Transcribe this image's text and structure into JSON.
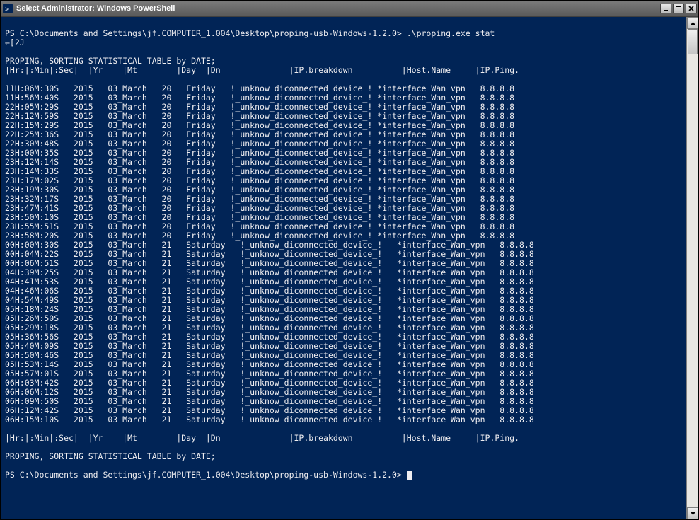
{
  "window": {
    "title": "Select Administrator: Windows PowerShell"
  },
  "prompt": {
    "path": "PS C:\\Documents and Settings\\jf.COMPUTER_1.004\\Desktop\\proping-usb-Windows-1.2.0>",
    "command": ".\\proping.exe stat"
  },
  "escape_seq": "←[2J",
  "heading": "PROPING, SORTING STATISTICAL TABLE by DATE;",
  "header_line": "|Hr:|:Min|:Sec|  |Yr    |Mt        |Day  |Dn              |IP.breakdown          |Host.Name     |IP.Ping.",
  "footer_header_line": "|Hr:|:Min|:Sec|  |Yr    |Mt        |Day  |Dn              |IP.breakdown          |Host.Name     |IP.Ping.",
  "table": [
    {
      "time": "11H:06M:30S",
      "yr": "2015",
      "mt": "03_March",
      "day": "20",
      "dn": "Friday",
      "ip": "!_unknow_diconnected_device_!",
      "host": "*interface_Wan_vpn",
      "ping": "8.8.8.8"
    },
    {
      "time": "11H:56M:40S",
      "yr": "2015",
      "mt": "03_March",
      "day": "20",
      "dn": "Friday",
      "ip": "!_unknow_diconnected_device_!",
      "host": "*interface_Wan_vpn",
      "ping": "8.8.8.8"
    },
    {
      "time": "22H:05M:29S",
      "yr": "2015",
      "mt": "03_March",
      "day": "20",
      "dn": "Friday",
      "ip": "!_unknow_diconnected_device_!",
      "host": "*interface_Wan_vpn",
      "ping": "8.8.8.8"
    },
    {
      "time": "22H:12M:59S",
      "yr": "2015",
      "mt": "03_March",
      "day": "20",
      "dn": "Friday",
      "ip": "!_unknow_diconnected_device_!",
      "host": "*interface_Wan_vpn",
      "ping": "8.8.8.8"
    },
    {
      "time": "22H:15M:29S",
      "yr": "2015",
      "mt": "03_March",
      "day": "20",
      "dn": "Friday",
      "ip": "!_unknow_diconnected_device_!",
      "host": "*interface_Wan_vpn",
      "ping": "8.8.8.8"
    },
    {
      "time": "22H:25M:36S",
      "yr": "2015",
      "mt": "03_March",
      "day": "20",
      "dn": "Friday",
      "ip": "!_unknow_diconnected_device_!",
      "host": "*interface_Wan_vpn",
      "ping": "8.8.8.8"
    },
    {
      "time": "22H:30M:48S",
      "yr": "2015",
      "mt": "03_March",
      "day": "20",
      "dn": "Friday",
      "ip": "!_unknow_diconnected_device_!",
      "host": "*interface_Wan_vpn",
      "ping": "8.8.8.8"
    },
    {
      "time": "23H:00M:35S",
      "yr": "2015",
      "mt": "03_March",
      "day": "20",
      "dn": "Friday",
      "ip": "!_unknow_diconnected_device_!",
      "host": "*interface_Wan_vpn",
      "ping": "8.8.8.8"
    },
    {
      "time": "23H:12M:14S",
      "yr": "2015",
      "mt": "03_March",
      "day": "20",
      "dn": "Friday",
      "ip": "!_unknow_diconnected_device_!",
      "host": "*interface_Wan_vpn",
      "ping": "8.8.8.8"
    },
    {
      "time": "23H:14M:33S",
      "yr": "2015",
      "mt": "03_March",
      "day": "20",
      "dn": "Friday",
      "ip": "!_unknow_diconnected_device_!",
      "host": "*interface_Wan_vpn",
      "ping": "8.8.8.8"
    },
    {
      "time": "23H:17M:02S",
      "yr": "2015",
      "mt": "03_March",
      "day": "20",
      "dn": "Friday",
      "ip": "!_unknow_diconnected_device_!",
      "host": "*interface_Wan_vpn",
      "ping": "8.8.8.8"
    },
    {
      "time": "23H:19M:30S",
      "yr": "2015",
      "mt": "03_March",
      "day": "20",
      "dn": "Friday",
      "ip": "!_unknow_diconnected_device_!",
      "host": "*interface_Wan_vpn",
      "ping": "8.8.8.8"
    },
    {
      "time": "23H:32M:17S",
      "yr": "2015",
      "mt": "03_March",
      "day": "20",
      "dn": "Friday",
      "ip": "!_unknow_diconnected_device_!",
      "host": "*interface_Wan_vpn",
      "ping": "8.8.8.8"
    },
    {
      "time": "23H:47M:41S",
      "yr": "2015",
      "mt": "03_March",
      "day": "20",
      "dn": "Friday",
      "ip": "!_unknow_diconnected_device_!",
      "host": "*interface_Wan_vpn",
      "ping": "8.8.8.8"
    },
    {
      "time": "23H:50M:10S",
      "yr": "2015",
      "mt": "03_March",
      "day": "20",
      "dn": "Friday",
      "ip": "!_unknow_diconnected_device_!",
      "host": "*interface_Wan_vpn",
      "ping": "8.8.8.8"
    },
    {
      "time": "23H:55M:51S",
      "yr": "2015",
      "mt": "03_March",
      "day": "20",
      "dn": "Friday",
      "ip": "!_unknow_diconnected_device_!",
      "host": "*interface_Wan_vpn",
      "ping": "8.8.8.8"
    },
    {
      "time": "23H:58M:20S",
      "yr": "2015",
      "mt": "03_March",
      "day": "20",
      "dn": "Friday",
      "ip": "!_unknow_diconnected_device_!",
      "host": "*interface_Wan_vpn",
      "ping": "8.8.8.8"
    },
    {
      "time": "00H:00M:30S",
      "yr": "2015",
      "mt": "03_March",
      "day": "21",
      "dn": "Saturday",
      "ip": "!_unknow_diconnected_device_!",
      "host": "*interface_Wan_vpn",
      "ping": "8.8.8.8"
    },
    {
      "time": "00H:04M:22S",
      "yr": "2015",
      "mt": "03_March",
      "day": "21",
      "dn": "Saturday",
      "ip": "!_unknow_diconnected_device_!",
      "host": "*interface_Wan_vpn",
      "ping": "8.8.8.8"
    },
    {
      "time": "00H:06M:51S",
      "yr": "2015",
      "mt": "03_March",
      "day": "21",
      "dn": "Saturday",
      "ip": "!_unknow_diconnected_device_!",
      "host": "*interface_Wan_vpn",
      "ping": "8.8.8.8"
    },
    {
      "time": "04H:39M:25S",
      "yr": "2015",
      "mt": "03_March",
      "day": "21",
      "dn": "Saturday",
      "ip": "!_unknow_diconnected_device_!",
      "host": "*interface_Wan_vpn",
      "ping": "8.8.8.8"
    },
    {
      "time": "04H:41M:53S",
      "yr": "2015",
      "mt": "03_March",
      "day": "21",
      "dn": "Saturday",
      "ip": "!_unknow_diconnected_device_!",
      "host": "*interface_Wan_vpn",
      "ping": "8.8.8.8"
    },
    {
      "time": "04H:46M:06S",
      "yr": "2015",
      "mt": "03_March",
      "day": "21",
      "dn": "Saturday",
      "ip": "!_unknow_diconnected_device_!",
      "host": "*interface_Wan_vpn",
      "ping": "8.8.8.8"
    },
    {
      "time": "04H:54M:49S",
      "yr": "2015",
      "mt": "03_March",
      "day": "21",
      "dn": "Saturday",
      "ip": "!_unknow_diconnected_device_!",
      "host": "*interface_Wan_vpn",
      "ping": "8.8.8.8"
    },
    {
      "time": "05H:18M:24S",
      "yr": "2015",
      "mt": "03_March",
      "day": "21",
      "dn": "Saturday",
      "ip": "!_unknow_diconnected_device_!",
      "host": "*interface_Wan_vpn",
      "ping": "8.8.8.8"
    },
    {
      "time": "05H:26M:50S",
      "yr": "2015",
      "mt": "03_March",
      "day": "21",
      "dn": "Saturday",
      "ip": "!_unknow_diconnected_device_!",
      "host": "*interface_Wan_vpn",
      "ping": "8.8.8.8"
    },
    {
      "time": "05H:29M:18S",
      "yr": "2015",
      "mt": "03_March",
      "day": "21",
      "dn": "Saturday",
      "ip": "!_unknow_diconnected_device_!",
      "host": "*interface_Wan_vpn",
      "ping": "8.8.8.8"
    },
    {
      "time": "05H:36M:56S",
      "yr": "2015",
      "mt": "03_March",
      "day": "21",
      "dn": "Saturday",
      "ip": "!_unknow_diconnected_device_!",
      "host": "*interface_Wan_vpn",
      "ping": "8.8.8.8"
    },
    {
      "time": "05H:40M:09S",
      "yr": "2015",
      "mt": "03_March",
      "day": "21",
      "dn": "Saturday",
      "ip": "!_unknow_diconnected_device_!",
      "host": "*interface_Wan_vpn",
      "ping": "8.8.8.8"
    },
    {
      "time": "05H:50M:46S",
      "yr": "2015",
      "mt": "03_March",
      "day": "21",
      "dn": "Saturday",
      "ip": "!_unknow_diconnected_device_!",
      "host": "*interface_Wan_vpn",
      "ping": "8.8.8.8"
    },
    {
      "time": "05H:53M:14S",
      "yr": "2015",
      "mt": "03_March",
      "day": "21",
      "dn": "Saturday",
      "ip": "!_unknow_diconnected_device_!",
      "host": "*interface_Wan_vpn",
      "ping": "8.8.8.8"
    },
    {
      "time": "05H:57M:01S",
      "yr": "2015",
      "mt": "03_March",
      "day": "21",
      "dn": "Saturday",
      "ip": "!_unknow_diconnected_device_!",
      "host": "*interface_Wan_vpn",
      "ping": "8.8.8.8"
    },
    {
      "time": "06H:03M:42S",
      "yr": "2015",
      "mt": "03_March",
      "day": "21",
      "dn": "Saturday",
      "ip": "!_unknow_diconnected_device_!",
      "host": "*interface_Wan_vpn",
      "ping": "8.8.8.8"
    },
    {
      "time": "06H:06M:12S",
      "yr": "2015",
      "mt": "03_March",
      "day": "21",
      "dn": "Saturday",
      "ip": "!_unknow_diconnected_device_!",
      "host": "*interface_Wan_vpn",
      "ping": "8.8.8.8"
    },
    {
      "time": "06H:09M:50S",
      "yr": "2015",
      "mt": "03_March",
      "day": "21",
      "dn": "Saturday",
      "ip": "!_unknow_diconnected_device_!",
      "host": "*interface_Wan_vpn",
      "ping": "8.8.8.8"
    },
    {
      "time": "06H:12M:42S",
      "yr": "2015",
      "mt": "03_March",
      "day": "21",
      "dn": "Saturday",
      "ip": "!_unknow_diconnected_device_!",
      "host": "*interface_Wan_vpn",
      "ping": "8.8.8.8"
    },
    {
      "time": "06H:15M:10S",
      "yr": "2015",
      "mt": "03_March",
      "day": "21",
      "dn": "Saturday",
      "ip": "!_unknow_diconnected_device_!",
      "host": "*interface_Wan_vpn",
      "ping": "8.8.8.8"
    }
  ],
  "footer_heading": "PROPING, SORTING STATISTICAL TABLE by DATE;",
  "prompt2": {
    "path": "PS C:\\Documents and Settings\\jf.COMPUTER_1.004\\Desktop\\proping-usb-Windows-1.2.0>"
  }
}
